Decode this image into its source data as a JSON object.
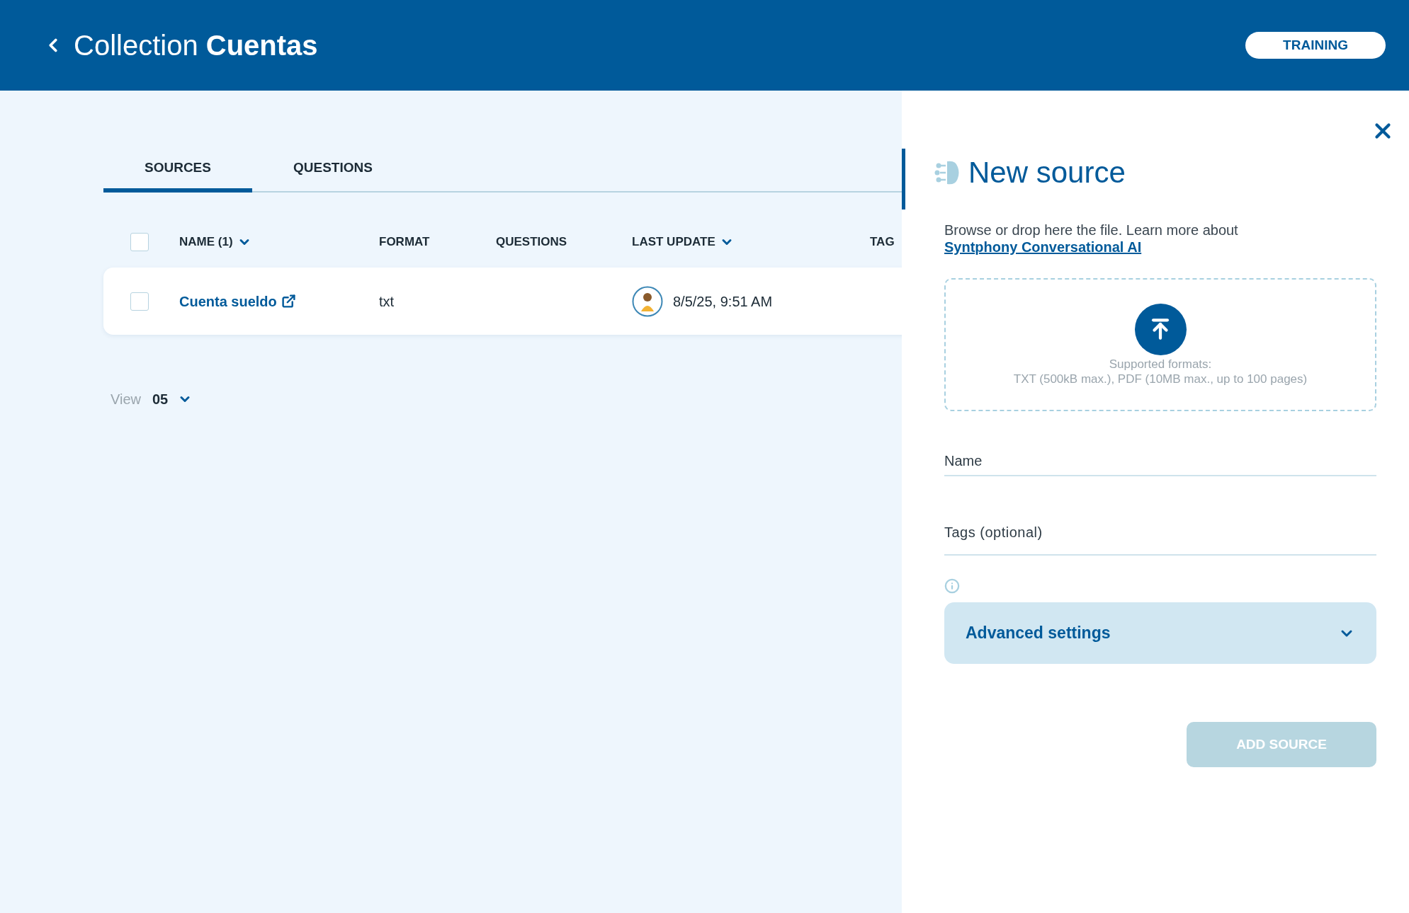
{
  "header": {
    "title_prefix": "Collection",
    "title_name": "Cuentas",
    "mode_button": "TRAINING"
  },
  "tabs": [
    {
      "label": "SOURCES",
      "selected": true
    },
    {
      "label": "QUESTIONS",
      "selected": false
    }
  ],
  "table": {
    "select_all_checked": false,
    "columns": [
      {
        "label": "NAME (1)",
        "sorted": true
      },
      {
        "label": "FORMAT",
        "sorted": false
      },
      {
        "label": "QUESTIONS",
        "sorted": false
      },
      {
        "label": "LAST UPDATE",
        "sorted": true
      },
      {
        "label": "TAG",
        "sorted": false
      }
    ],
    "rows": [
      {
        "checked": false,
        "name": "Cuenta sueldo",
        "format": "txt",
        "questions": "",
        "last_update": "8/5/25, 9:51 AM"
      }
    ]
  },
  "pagination": {
    "label": "View",
    "value": "05"
  },
  "panel": {
    "title": "New source",
    "description": "Browse or drop here the file. Learn more about ",
    "link": "Syntphony Conversational AI",
    "dropzone": {
      "formats_title": "Supported formats:",
      "formats": "TXT (500kB max.), PDF (10MB max., up to 100 pages)"
    },
    "fields": [
      {
        "placeholder": "Name"
      },
      {
        "placeholder": "Tags (optional)"
      }
    ],
    "advanced": {
      "label": "Advanced settings",
      "expanded": false
    },
    "submit": {
      "label": "ADD SOURCE",
      "disabled": true
    }
  }
}
